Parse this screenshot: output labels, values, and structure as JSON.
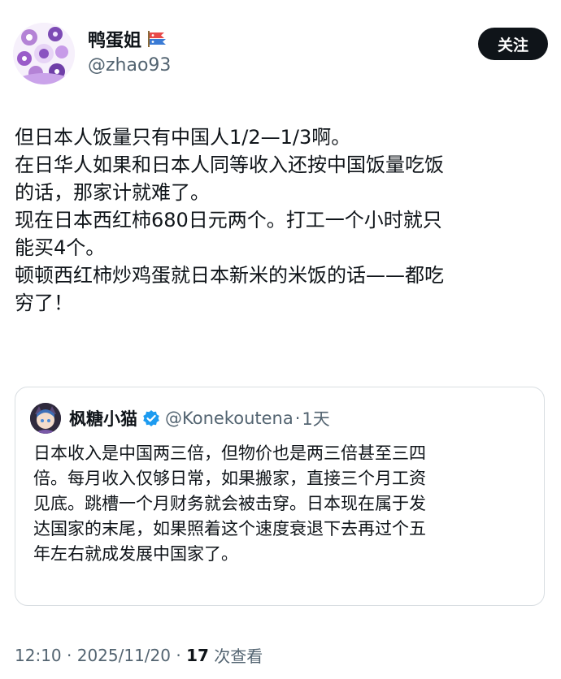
{
  "author": {
    "display_name": "鸭蛋姐",
    "handle": "@zhao93",
    "follow_label": "关注",
    "avatar_icon": "floral-avatar",
    "name_badge_icon": "koinobori-flag-icon"
  },
  "post": {
    "lines": [
      "但日本人饭量只有中国人1/2—1/3啊。",
      "在日华人如果和日本人同等收入还按中国饭量吃饭",
      "的话，那家计就难了。",
      "现在日本西红柿680日元两个。打工一个小时就只",
      "能买4个。",
      "顿顿西红柿炒鸡蛋就日本新米的米饭的话——都吃",
      "穷了！"
    ]
  },
  "quote": {
    "display_name": "枫糖小猫",
    "handle": "@Konekoutena",
    "separator": "·",
    "time": "1天",
    "verified_color": "#1d9bf0",
    "lines": [
      "日本收入是中国两三倍，但物价也是两三倍甚至三四",
      "倍。每月收入仅够日常，如果搬家，直接三个月工资",
      "见底。跳槽一个月财务就会被击穿。日本现在属于发",
      "达国家的末尾，如果照着这个速度衰退下去再过个五",
      "年左右就成发展中国家了。"
    ]
  },
  "meta": {
    "time": "12:10",
    "sep1": " · ",
    "date": "2025/11/20",
    "sep2": " · ",
    "views": "17",
    "views_label": " 次查看"
  }
}
